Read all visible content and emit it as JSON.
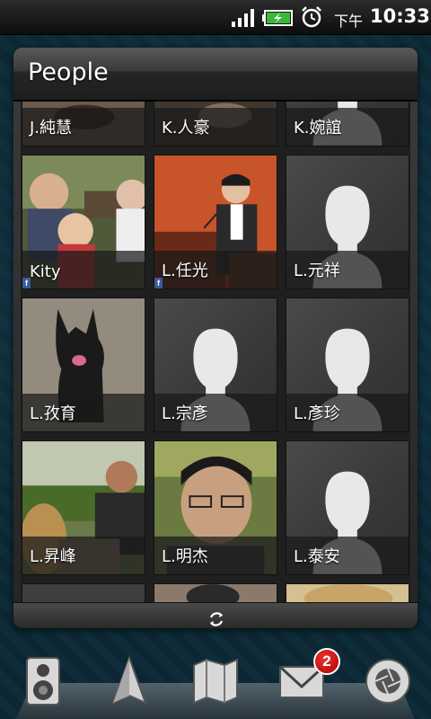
{
  "status_bar": {
    "ampm": "下午",
    "time": "10:33",
    "icons": [
      "signal-icon",
      "battery-charging-icon",
      "alarm-clock-icon"
    ]
  },
  "widget": {
    "title": "People",
    "contacts": [
      {
        "name": "J.純慧",
        "photo": "person"
      },
      {
        "name": "K.人豪",
        "photo": "person"
      },
      {
        "name": "K.婉誼",
        "photo": "placeholder"
      },
      {
        "name": "Kity",
        "photo": "family",
        "facebook": true
      },
      {
        "name": "L.任光",
        "photo": "speaker",
        "facebook": true
      },
      {
        "name": "L.元祥",
        "photo": "placeholder"
      },
      {
        "name": "L.孜育",
        "photo": "dog"
      },
      {
        "name": "L.宗彥",
        "photo": "placeholder"
      },
      {
        "name": "L.彥珍",
        "photo": "placeholder"
      },
      {
        "name": "L.昇峰",
        "photo": "outdoor-man"
      },
      {
        "name": "L.明杰",
        "photo": "glasses-man"
      },
      {
        "name": "L.泰安",
        "photo": "placeholder"
      }
    ],
    "footer_icon": "refresh-icon"
  },
  "dock": {
    "items": [
      {
        "icon": "speaker-icon"
      },
      {
        "icon": "navigation-arrow-icon"
      },
      {
        "icon": "map-icon"
      },
      {
        "icon": "mail-icon",
        "badge": "2"
      },
      {
        "icon": "camera-aperture-icon"
      }
    ]
  }
}
